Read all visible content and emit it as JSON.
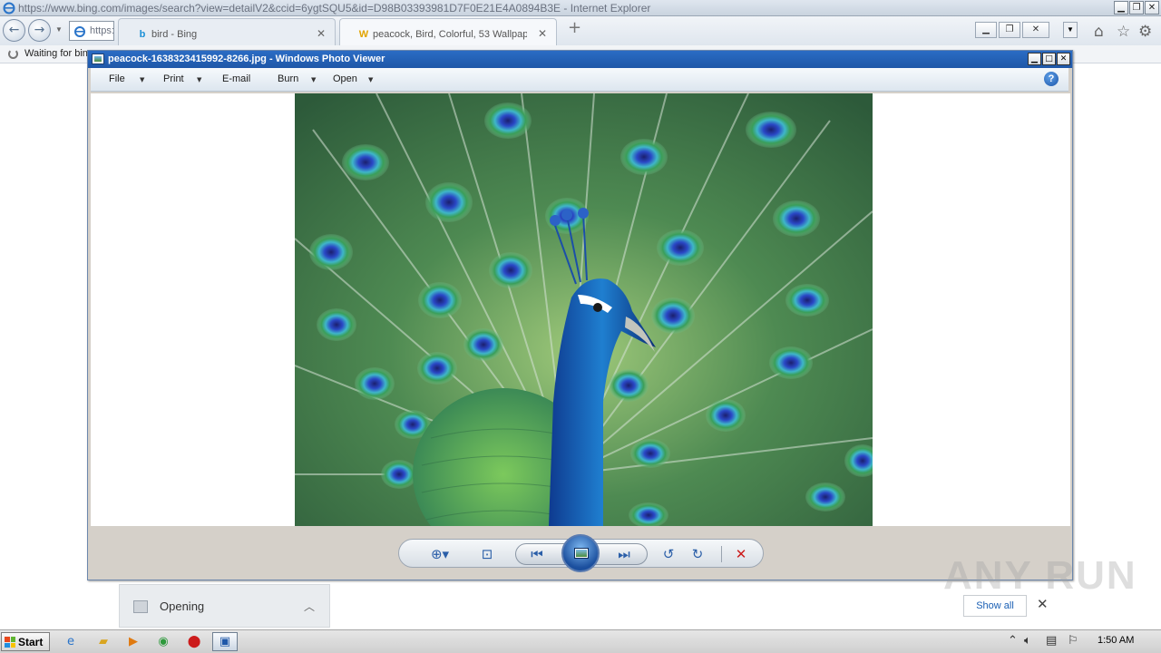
{
  "browser": {
    "title": "https://www.bing.com/images/search?view=detailV2&ccid=6ygtSQU5&id=D98B03393981D7F0E21E4A0894B3E - Internet Explorer",
    "address_text": "https:",
    "status_text": "Waiting for bin",
    "tabs": [
      {
        "label": "bird - Bing",
        "icon": "bing-icon"
      },
      {
        "label": "peacock, Bird, Colorful, 53 Wallpapers",
        "icon": "wallpaper-site-icon"
      }
    ]
  },
  "photo_viewer": {
    "title": "peacock-1638323415992-8266.jpg - Windows Photo Viewer",
    "menu": {
      "file": "File",
      "print": "Print",
      "email": "E-mail",
      "burn": "Burn",
      "open": "Open"
    },
    "help": "?"
  },
  "downloads": {
    "item_label": "Opening",
    "show_all": "Show all"
  },
  "watermark": "ANY RUN",
  "taskbar": {
    "start_label": "Start",
    "clock": "1:50 AM"
  },
  "colors": {
    "viewer_titlebar": "#1e57a8",
    "delete_red": "#cc1b1b",
    "control_blue": "#2a5ea8"
  }
}
